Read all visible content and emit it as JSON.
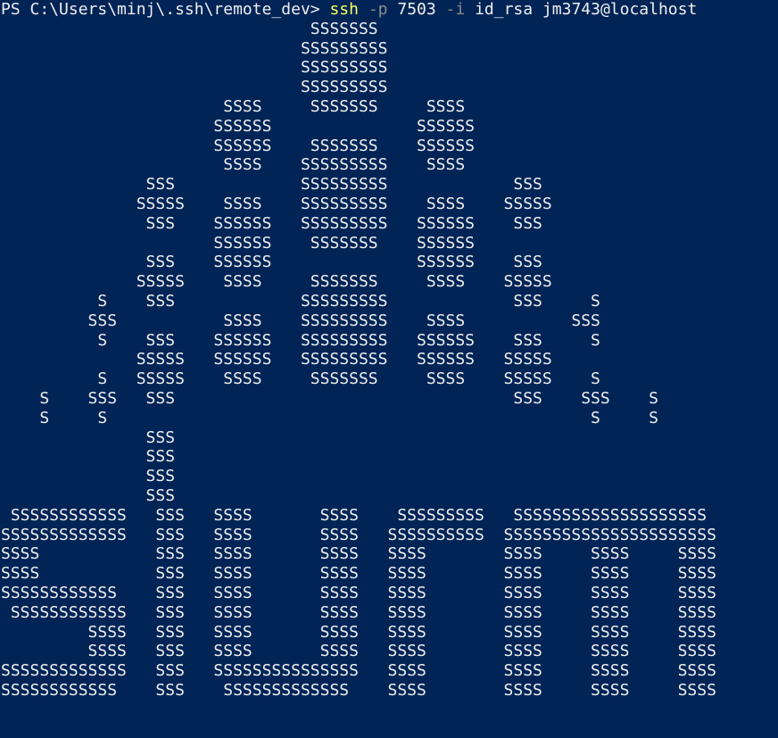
{
  "window": {
    "background": "#012456"
  },
  "prompt": {
    "path": "PS C:\\Users\\minj\\.ssh\\remote_dev> ",
    "command": "ssh",
    "sp1": " ",
    "flag_p": "-p",
    "port": " 7503 ",
    "flag_i": "-i",
    "key_and_host": " id_rsa jm3743@localhost"
  },
  "art_lines": [
    "                                SSSSSSS",
    "                               SSSSSSSSS",
    "                               SSSSSSSSS",
    "                               SSSSSSSSS",
    "                       SSSS     SSSSSSS     SSSS",
    "                      SSSSSS               SSSSSS",
    "                      SSSSSS    SSSSSSS    SSSSSS",
    "                       SSSS    SSSSSSSSS    SSSS",
    "               SSS             SSSSSSSSS             SSS",
    "              SSSSS    SSSS    SSSSSSSSS    SSSS    SSSSS",
    "               SSS    SSSSSS   SSSSSSSSS   SSSSSS    SSS",
    "                      SSSSSS    SSSSSSS    SSSSSS",
    "               SSS    SSSSSS               SSSSSS    SSS",
    "              SSSSS    SSSS     SSSSSSS     SSSS    SSSSS",
    "          S    SSS             SSSSSSSSS             SSS     S",
    "         SSS           SSSS    SSSSSSSSS    SSSS           SSS",
    "          S    SSS    SSSSSS   SSSSSSSSS   SSSSSS    SSS     S",
    "              SSSSS   SSSSSS   SSSSSSSSS   SSSSSS   SSSSS",
    "          S   SSSSS    SSSS     SSSSSSS     SSSS    SSSSS    S",
    "    S    SSS   SSS                                   SSS    SSS    S",
    "    S     S                                                  S     S",
    "               SSS",
    "               SSS",
    "               SSS",
    "               SSS",
    " SSSSSSSSSSSS   SSS   SSSS       SSSS    SSSSSSSSS   SSSSSSSSSSSSSSSSSSSS",
    "SSSSSSSSSSSSS   SSS   SSSS       SSSS   SSSSSSSSSS  SSSSSSSSSSSSSSSSSSSSSS",
    "SSSS            SSS   SSSS       SSSS   SSSS        SSSS     SSSS     SSSS",
    "SSSS            SSS   SSSS       SSSS   SSSS        SSSS     SSSS     SSSS",
    "SSSSSSSSSSSS    SSS   SSSS       SSSS   SSSS        SSSS     SSSS     SSSS",
    " SSSSSSSSSSSS   SSS   SSSS       SSSS   SSSS        SSSS     SSSS     SSSS",
    "         SSSS   SSS   SSSS       SSSS   SSSS        SSSS     SSSS     SSSS",
    "         SSSS   SSS   SSSS       SSSS   SSSS        SSSS     SSSS     SSSS",
    "SSSSSSSSSSSSS   SSS   SSSSSSSSSSSSSSS   SSSS        SSSS     SSSS     SSSS",
    "SSSSSSSSSSSS    SSS    SSSSSSSSSSSSS    SSSS        SSSS     SSSS     SSSS"
  ]
}
